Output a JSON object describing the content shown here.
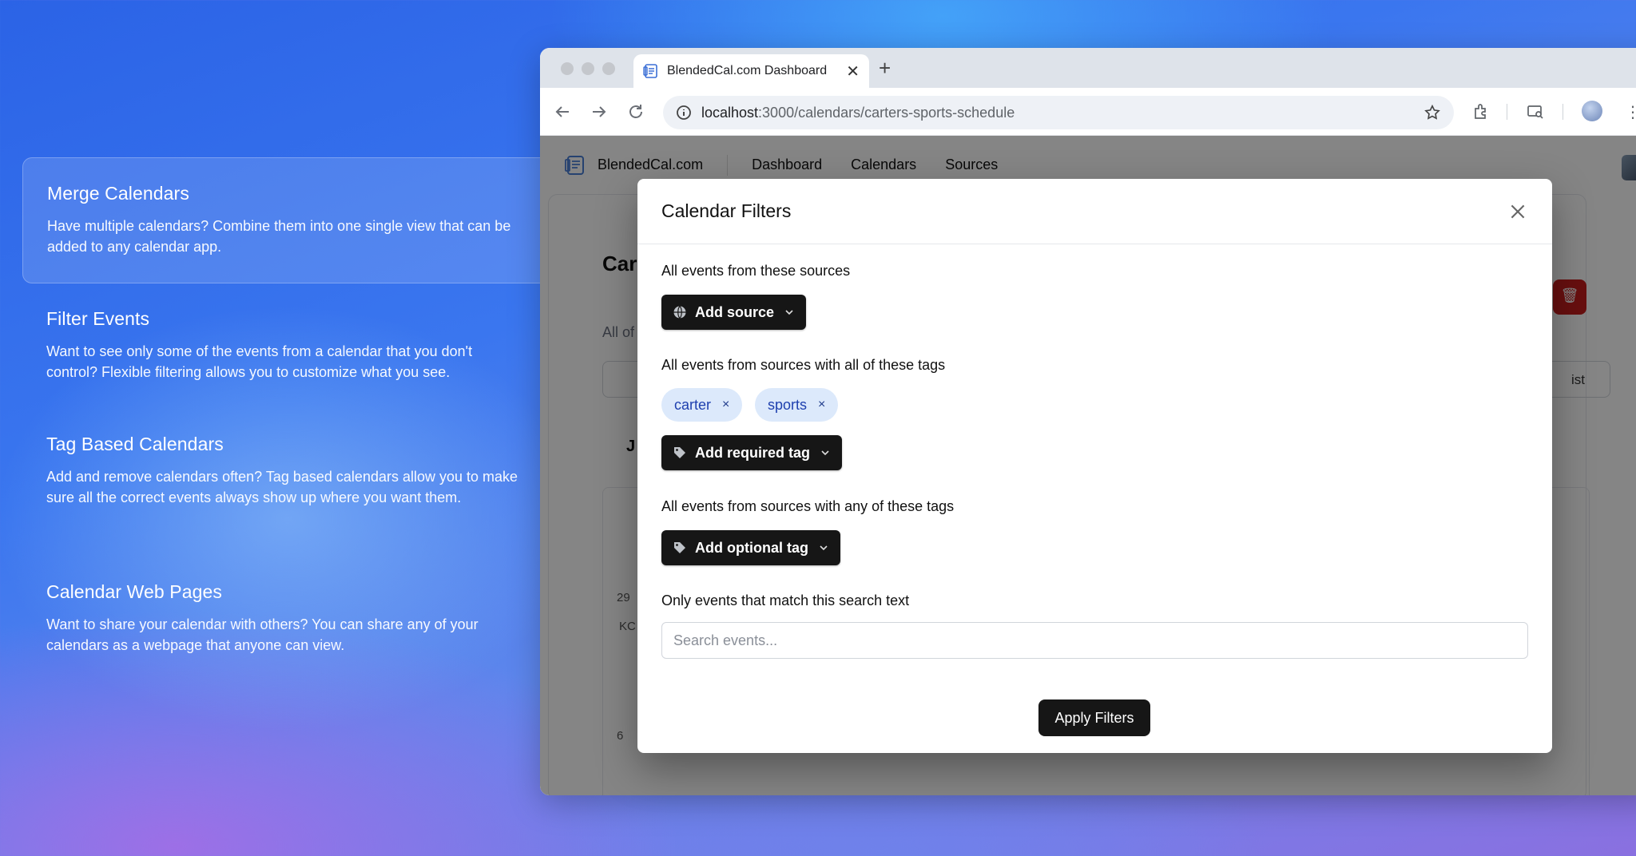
{
  "features": [
    {
      "title": "Merge Calendars",
      "desc": "Have multiple calendars? Combine them into one single view that can be added to any calendar app."
    },
    {
      "title": "Filter Events",
      "desc": "Want to see only some of the events from a calendar that you don't control? Flexible filtering allows you to customize what you see."
    },
    {
      "title": "Tag Based Calendars",
      "desc": "Add and remove calendars often? Tag based calendars allow you to make sure all the correct events always show up where you want them."
    },
    {
      "title": "Calendar Web Pages",
      "desc": "Want to share your calendar with others? You can share any of your calendars as a webpage that anyone can view."
    }
  ],
  "browser": {
    "tab_title": "BlendedCal.com Dashboard",
    "tab_close": "✕",
    "new_tab": "+",
    "url_host": "localhost",
    "url_path": ":3000/calendars/carters-sports-schedule"
  },
  "app": {
    "brand": "BlendedCal.com",
    "nav": [
      "Dashboard",
      "Calendars",
      "Sources"
    ],
    "bg_title": "Car",
    "bg_sub": "All of",
    "bg_list": "ist",
    "bg_j": "J",
    "bg_days": [
      "29",
      "KC",
      "6"
    ]
  },
  "modal": {
    "title": "Calendar Filters",
    "sources_label": "All events from these sources",
    "add_source": "Add source",
    "required_label": "All events from sources with all of these tags",
    "required_tags": [
      "carter",
      "sports"
    ],
    "tag_remove": "×",
    "add_required": "Add required tag",
    "optional_label": "All events from sources with any of these tags",
    "add_optional": "Add optional tag",
    "search_label": "Only events that match this search text",
    "search_placeholder": "Search events...",
    "search_value": "",
    "apply": "Apply Filters"
  }
}
